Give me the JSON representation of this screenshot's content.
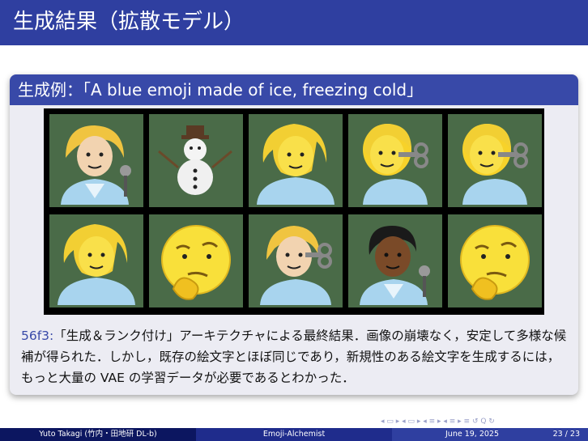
{
  "slide_title": "生成結果（拡散モデル）",
  "block": {
    "title": "生成例：「A blue emoji made of ice, freezing cold」"
  },
  "grid": {
    "rows": 2,
    "columns": 5,
    "cell_background": "#4a6b48",
    "items": [
      "woman-with-microphone-emoji",
      "snowman-emoji",
      "woman-raising-hand-emoji",
      "woman-with-key-emoji",
      "woman-with-key-emoji",
      "woman-raising-hand-emoji",
      "thinking-face-emoji",
      "woman-with-key-emoji",
      "dark-skin-man-with-microphone-emoji",
      "thinking-face-emoji"
    ]
  },
  "caption": {
    "label": "56f3:",
    "text": "「生成＆ランク付け」アーキテクチャによる最終結果．画像の崩壊なく，安定して多様な候補が得られた．しかし，既存の絵文字とほぼ同じであり，新規性のある絵文字を生成するには，もっと大量の VAE の学習データが必要であるとわかった．"
  },
  "footer": {
    "author": "Yuto Takagi (竹内・田地研 DL-b)",
    "title": "Emoji-Alchemist",
    "date": "June 19, 2025",
    "page": "23 / 23"
  },
  "colors": {
    "title_bar": "#2f3fa0",
    "block_head": "#3849a8",
    "block_body": "#ececf3",
    "footer_dark": "#0c1660",
    "footer_mid": "#1f2c8c",
    "footer_light": "#2f3fa0"
  }
}
